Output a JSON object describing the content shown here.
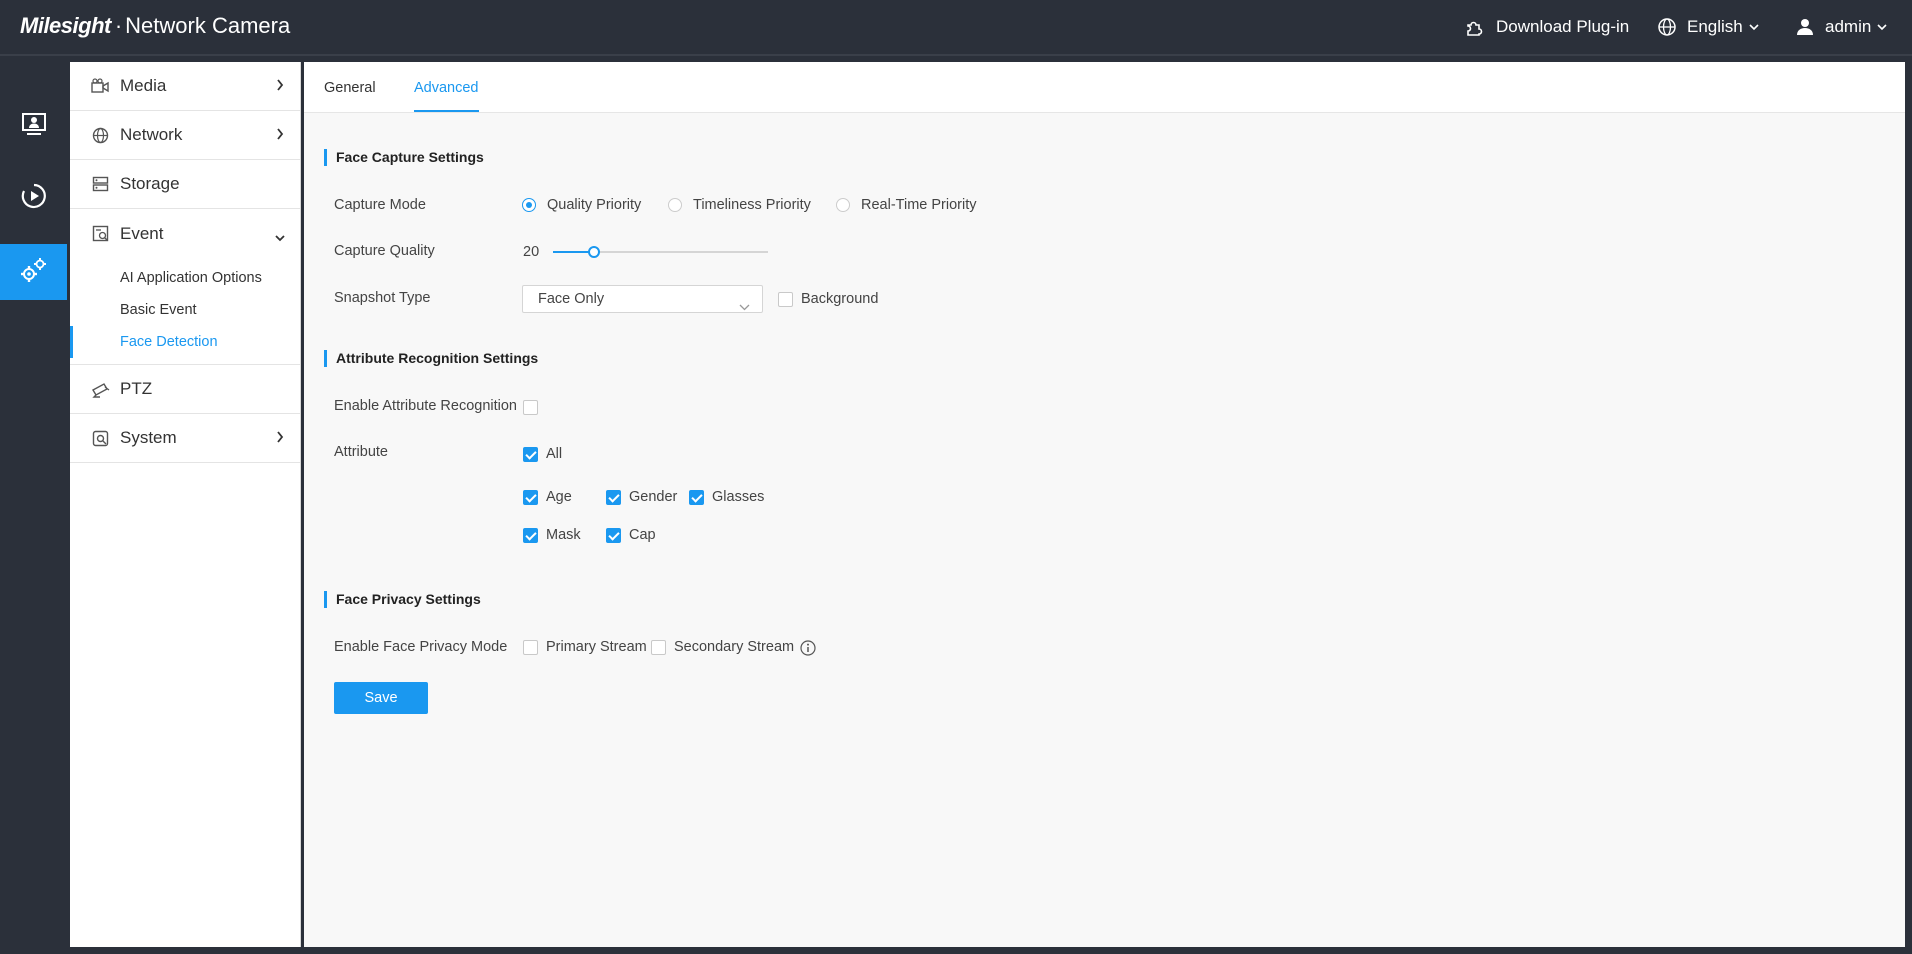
{
  "app": {
    "brand_logo": "Milesight",
    "brand_product": "Network Camera"
  },
  "topbar": {
    "download_plugin": "Download Plug-in",
    "language": "English",
    "user": "admin"
  },
  "rail": {
    "items": [
      {
        "name": "live-view",
        "icon": "monitor-person-icon"
      },
      {
        "name": "playback",
        "icon": "play-circle-icon"
      },
      {
        "name": "settings",
        "icon": "gears-icon",
        "active": true
      }
    ]
  },
  "sidebar": {
    "media": "Media",
    "network": "Network",
    "storage": "Storage",
    "event": "Event",
    "event_sub": {
      "ai_options": "AI Application Options",
      "basic_event": "Basic Event",
      "face_detection": "Face Detection"
    },
    "ptz": "PTZ",
    "system": "System"
  },
  "tabs": {
    "general": "General",
    "advanced": "Advanced"
  },
  "face_capture": {
    "title": "Face Capture Settings",
    "capture_mode_label": "Capture Mode",
    "modes": {
      "quality": "Quality Priority",
      "timeliness": "Timeliness Priority",
      "realtime": "Real-Time Priority"
    },
    "selected_mode": "Quality Priority",
    "capture_quality_label": "Capture Quality",
    "capture_quality_value": "20",
    "capture_quality_fraction": 0.19,
    "snapshot_type_label": "Snapshot Type",
    "snapshot_type_value": "Face Only",
    "background_label": "Background",
    "background_checked": false
  },
  "attribute": {
    "title": "Attribute Recognition Settings",
    "enable_label": "Enable Attribute Recognition",
    "enable_checked": false,
    "attribute_label": "Attribute",
    "all": "All",
    "age": "Age",
    "gender": "Gender",
    "glasses": "Glasses",
    "mask": "Mask",
    "cap": "Cap"
  },
  "privacy": {
    "title": "Face Privacy Settings",
    "enable_label": "Enable Face Privacy Mode",
    "primary": "Primary Stream",
    "secondary": "Secondary Stream"
  },
  "actions": {
    "save": "Save"
  },
  "colors": {
    "accent": "#1a98f0",
    "dark_bg": "#2b303a"
  }
}
